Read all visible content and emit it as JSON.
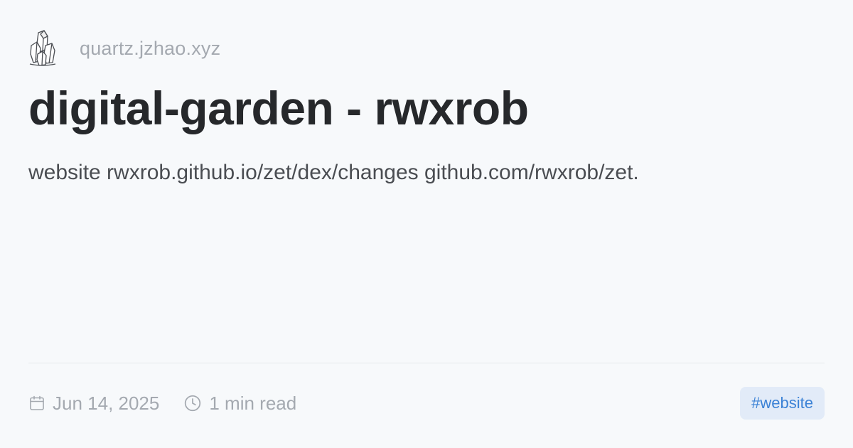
{
  "site": {
    "logo_icon": "crystal-logo-icon",
    "name": "quartz.jzhao.xyz"
  },
  "page": {
    "title": "digital-garden - rwxrob",
    "description": "website rwxrob.github.io/zet/dex/changes github.com/rwxrob/zet."
  },
  "meta": {
    "date_icon": "calendar-icon",
    "date": "Jun 14, 2025",
    "read_icon": "clock-icon",
    "read_time": "1 min read"
  },
  "tags": [
    "#website"
  ],
  "colors": {
    "background": "#f7f9fb",
    "title": "#26282b",
    "muted": "#a4a9b0",
    "tag_bg": "#e2ebf8",
    "tag_text": "#3b82d6"
  }
}
